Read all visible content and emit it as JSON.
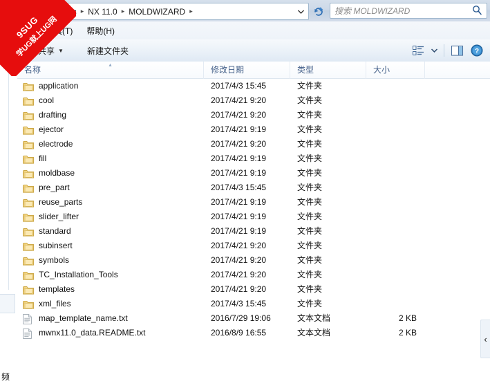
{
  "window": {
    "address": {
      "breadcrumbs": [
        "Siemens",
        "NX 11.0",
        "MOLDWIZARD"
      ],
      "separator": "▸",
      "dropdown_icon": "chevron-down-icon",
      "refresh_icon": "refresh-icon"
    },
    "search": {
      "placeholder": "搜索 MOLDWIZARD",
      "icon": "search-icon"
    }
  },
  "menubar": {
    "items": [
      {
        "label": "工具(T)",
        "name": "menu-tools"
      },
      {
        "label": "帮助(H)",
        "name": "menu-help"
      }
    ]
  },
  "toolbar": {
    "share_label": "共享",
    "share_caret": "▼",
    "new_folder_label": "新建文件夹",
    "view_icon": "view-options-icon",
    "view_caret": "▼",
    "preview_pane_icon": "preview-pane-icon",
    "help_icon": "help-icon"
  },
  "columns": [
    {
      "label": "名称",
      "name": "column-name",
      "sorted": true,
      "sort_arrow": "▴"
    },
    {
      "label": "修改日期",
      "name": "column-date-modified"
    },
    {
      "label": "类型",
      "name": "column-type"
    },
    {
      "label": "大小",
      "name": "column-size"
    }
  ],
  "files": [
    {
      "name": "application",
      "date": "2017/4/3 15:45",
      "type": "文件夹",
      "size": "",
      "icon": "folder-icon"
    },
    {
      "name": "cool",
      "date": "2017/4/21 9:20",
      "type": "文件夹",
      "size": "",
      "icon": "folder-icon"
    },
    {
      "name": "drafting",
      "date": "2017/4/21 9:20",
      "type": "文件夹",
      "size": "",
      "icon": "folder-icon"
    },
    {
      "name": "ejector",
      "date": "2017/4/21 9:19",
      "type": "文件夹",
      "size": "",
      "icon": "folder-icon"
    },
    {
      "name": "electrode",
      "date": "2017/4/21 9:20",
      "type": "文件夹",
      "size": "",
      "icon": "folder-icon"
    },
    {
      "name": "fill",
      "date": "2017/4/21 9:19",
      "type": "文件夹",
      "size": "",
      "icon": "folder-icon"
    },
    {
      "name": "moldbase",
      "date": "2017/4/21 9:19",
      "type": "文件夹",
      "size": "",
      "icon": "folder-icon"
    },
    {
      "name": "pre_part",
      "date": "2017/4/3 15:45",
      "type": "文件夹",
      "size": "",
      "icon": "folder-icon"
    },
    {
      "name": "reuse_parts",
      "date": "2017/4/21 9:19",
      "type": "文件夹",
      "size": "",
      "icon": "folder-icon"
    },
    {
      "name": "slider_lifter",
      "date": "2017/4/21 9:19",
      "type": "文件夹",
      "size": "",
      "icon": "folder-icon"
    },
    {
      "name": "standard",
      "date": "2017/4/21 9:19",
      "type": "文件夹",
      "size": "",
      "icon": "folder-icon"
    },
    {
      "name": "subinsert",
      "date": "2017/4/21 9:20",
      "type": "文件夹",
      "size": "",
      "icon": "folder-icon"
    },
    {
      "name": "symbols",
      "date": "2017/4/21 9:20",
      "type": "文件夹",
      "size": "",
      "icon": "folder-icon"
    },
    {
      "name": "TC_Installation_Tools",
      "date": "2017/4/21 9:20",
      "type": "文件夹",
      "size": "",
      "icon": "folder-icon"
    },
    {
      "name": "templates",
      "date": "2017/4/21 9:20",
      "type": "文件夹",
      "size": "",
      "icon": "folder-icon"
    },
    {
      "name": "xml_files",
      "date": "2017/4/3 15:45",
      "type": "文件夹",
      "size": "",
      "icon": "folder-icon"
    },
    {
      "name": "map_template_name.txt",
      "date": "2016/7/29 19:06",
      "type": "文本文档",
      "size": "2 KB",
      "icon": "text-file-icon"
    },
    {
      "name": "mwnx11.0_data.README.txt",
      "date": "2016/8/9 16:55",
      "type": "文本文档",
      "size": "2 KB",
      "icon": "text-file-icon"
    }
  ],
  "sidebar": {
    "bottom_partial_label": "频"
  },
  "right_handle": {
    "icon": "chevron-left-icon",
    "glyph": "‹"
  },
  "watermark": {
    "line1": "9SUG",
    "line2": "学UG就上UG网",
    "color": "#e60d0d"
  }
}
